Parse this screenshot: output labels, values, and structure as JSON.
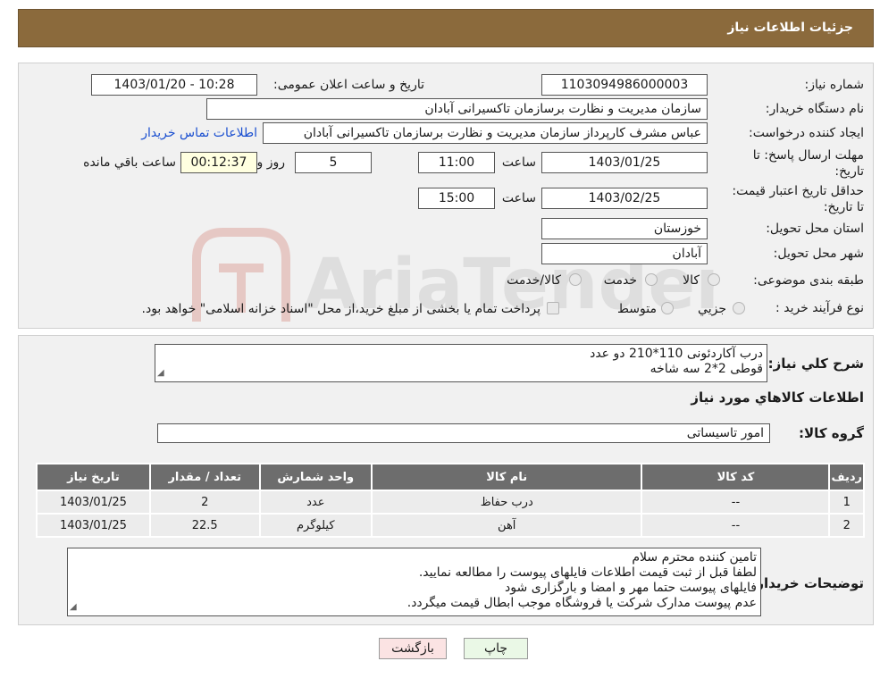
{
  "header": {
    "title": "جزئیات اطلاعات نیاز"
  },
  "need_number": {
    "label": "شماره نیاز:",
    "value": "1103094986000003"
  },
  "announce": {
    "label": "تاریخ و ساعت اعلان عمومی:",
    "value": "1403/01/20 - 10:28"
  },
  "buyer": {
    "label": "نام دستگاه خریدار:",
    "value": "سازمان مدیریت و نظارت برسازمان تاکسیرانی آبادان"
  },
  "creator": {
    "label": "ایجاد کننده درخواست:",
    "value": "عباس مشرف کارپرداز سازمان مدیریت و نظارت برسازمان تاکسیرانی آبادان",
    "contact_link": "اطلاعات تماس خریدار"
  },
  "deadline": {
    "label": "مهلت ارسال پاسخ: تا تاریخ:",
    "date": "1403/01/25",
    "time_label": "ساعت",
    "time": "11:00",
    "days": "5",
    "days_label": "روز و",
    "remaining": "00:12:37",
    "remaining_label": "ساعت باقي مانده"
  },
  "validity": {
    "label": "حداقل تاریخ اعتبار قیمت: تا تاریخ:",
    "date": "1403/02/25",
    "time_label": "ساعت",
    "time": "15:00"
  },
  "province": {
    "label": "استان محل تحویل:",
    "value": "خوزستان"
  },
  "city": {
    "label": "شهر محل تحویل:",
    "value": "آبادان"
  },
  "category": {
    "label": "طبقه بندی موضوعی:",
    "options": [
      "کالا",
      "خدمت",
      "کالا/خدمت"
    ]
  },
  "purchase_type": {
    "label": "نوع فرآیند خرید :",
    "options": [
      "جزیي",
      "متوسط"
    ],
    "note": "پرداخت تمام یا بخشی از مبلغ خرید،از محل \"اسناد خزانه اسلامی\" خواهد بود."
  },
  "description": {
    "label": "شرح کلي نياز:",
    "lines": [
      "درب آکاردئونی 110*210 دو عدد",
      "قوطی 2*2 سه شاخه"
    ]
  },
  "goods_info_title": "اطلاعات کالاهاي مورد نياز",
  "goods_group": {
    "label": "گروه کالا:",
    "value": "امور تاسیساتی"
  },
  "table": {
    "headers": [
      "رديف",
      "کد کالا",
      "نام کالا",
      "واحد شمارش",
      "تعداد / مقدار",
      "تاريخ نياز"
    ],
    "rows": [
      [
        "1",
        "--",
        "درب حفاظ",
        "عدد",
        "2",
        "1403/01/25"
      ],
      [
        "2",
        "--",
        "آهن",
        "کیلوگرم",
        "22.5",
        "1403/01/25"
      ]
    ]
  },
  "buyer_notes": {
    "label": "توضيحات خريدار:",
    "lines": [
      "تامین کننده محترم سلام",
      "لطفا قبل از ثبت قیمت اطلاعات فایلهای پیوست را مطالعه نمایید.",
      "فایلهای پیوست حتما مهر و امضا و بارگزاری شود",
      "عدم پیوست مدارک شرکت یا فروشگاه موجب ابطال قیمت میگردد."
    ]
  },
  "buttons": {
    "print": "چاپ",
    "back": "بازگشت"
  },
  "watermark": {
    "text": "AriaTender.neT"
  },
  "colors": {
    "header_bg": "#8b6a3c",
    "table_header_bg": "#6d6d6d",
    "link": "#1a4fd0"
  }
}
